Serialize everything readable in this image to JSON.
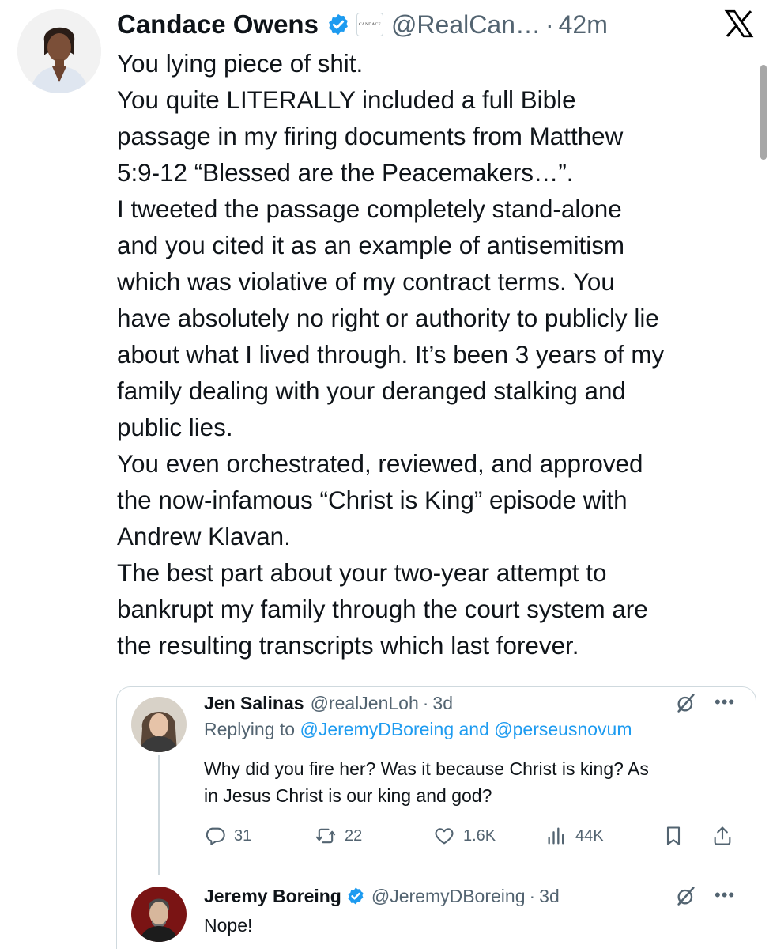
{
  "tweet": {
    "author_name": "Candace Owens",
    "affiliate_badge_text": "CANDACE",
    "handle": "@RealCan…",
    "separator": "·",
    "time": "42m",
    "body_lines": [
      "You lying piece of shit.",
      "You quite LITERALLY included a full Bible",
      "passage in my firing documents from Matthew",
      "5:9-12 “Blessed are the Peacemakers…”.",
      "I tweeted the passage completely stand-alone",
      "and you cited it as an example of antisemitism",
      "which was violative of my contract terms. You",
      "have absolutely no right or authority to publicly lie",
      "about what I lived through. It’s been 3 years of my",
      "family dealing with your deranged stalking and",
      "public lies.",
      "You even orchestrated, reviewed, and approved",
      "the now-infamous “Christ is King” episode with",
      "Andrew Klavan.",
      "The best part about your two-year attempt to",
      "bankrupt my family through the court system are",
      "the resulting transcripts which last forever."
    ]
  },
  "quoted": {
    "reply1": {
      "name": "Jen Salinas",
      "handle": "@realJenLoh",
      "separator": "·",
      "time": "3d",
      "replying_prefix": "Replying to",
      "mention1": "@JeremyDBoreing",
      "and_word": "and",
      "mention2": "@perseusnovum",
      "text_lines": [
        "Why did you fire her? Was it because Christ is king? As",
        "in Jesus Christ is our king and god?"
      ],
      "stats": {
        "replies": "31",
        "reposts": "22",
        "likes": "1.6K",
        "views": "44K"
      }
    },
    "reply2": {
      "name": "Jeremy Boreing",
      "handle": "@JeremyDBoreing",
      "separator": "·",
      "time": "3d",
      "text": "Nope!"
    },
    "more_label": "•••"
  },
  "icons": {
    "verified": "verified-badge-icon",
    "x_logo": "x-logo-icon",
    "grok": "grok-icon",
    "reply": "reply-icon",
    "repost": "repost-icon",
    "like": "like-icon",
    "views": "views-icon",
    "bookmark": "bookmark-icon",
    "share": "share-icon"
  },
  "colors": {
    "text": "#0f1419",
    "secondary": "#536471",
    "link": "#1d9bf0",
    "verified": "#1d9bf0",
    "border": "#cfd9de"
  }
}
